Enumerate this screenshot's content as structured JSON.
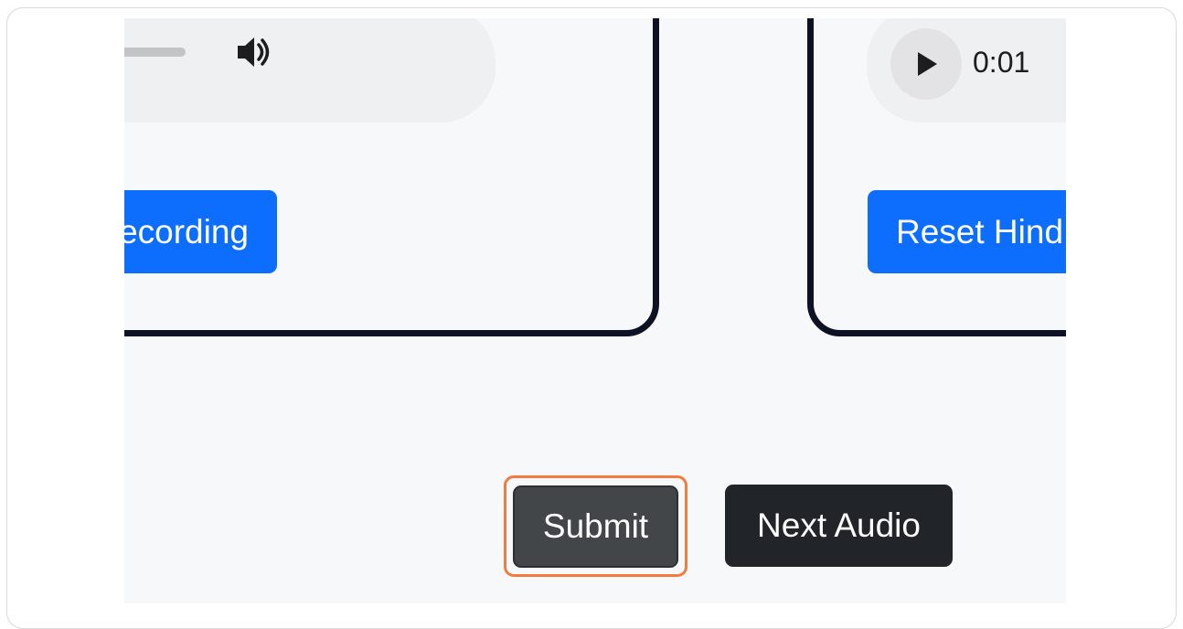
{
  "left_card": {
    "audio_player": {
      "volume_icon": "volume-icon"
    },
    "button_label": "ecording"
  },
  "right_card": {
    "audio_player": {
      "play_icon": "play-icon",
      "time": "0:01"
    },
    "button_label": "Reset Hind"
  },
  "actions": {
    "submit_label": "Submit",
    "next_label": "Next Audio"
  },
  "colors": {
    "primary_blue": "#0d6efd",
    "dark_button": "#212529",
    "submit_button": "#424649",
    "highlight_outline": "#f47b3f",
    "card_border": "#0d1224",
    "background": "#f7f8fa"
  }
}
